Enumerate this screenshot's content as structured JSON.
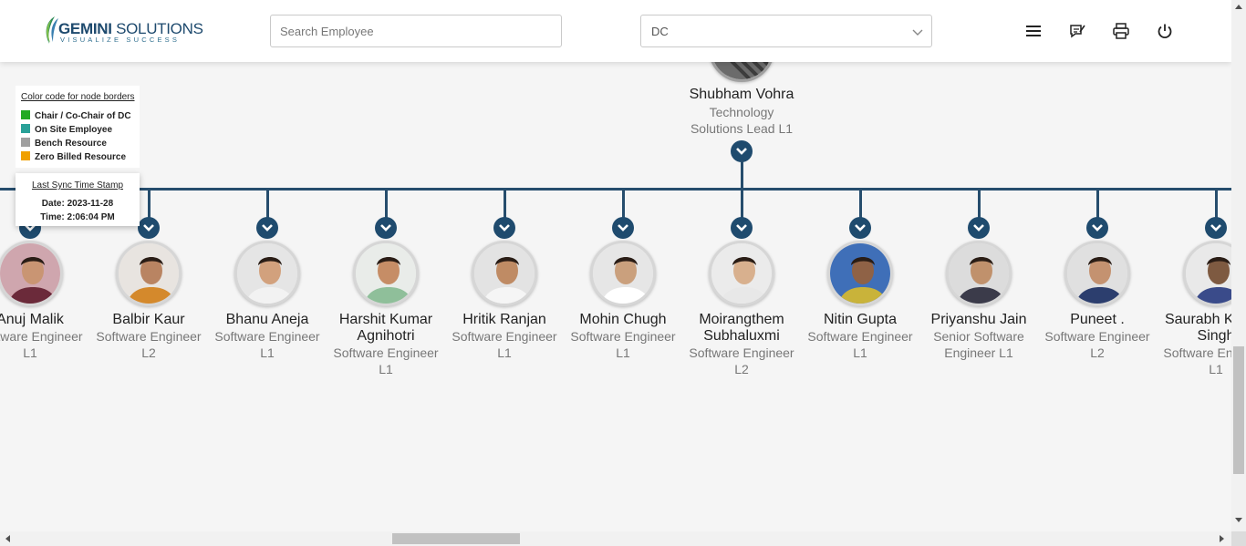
{
  "header": {
    "logo_name_bold": "GEMINI",
    "logo_name_rest": " SOLUTIONS",
    "logo_tagline": "VISUALIZE SUCCESS",
    "search_placeholder": "Search Employee",
    "dc_select_value": "DC",
    "icons": [
      "menu-icon",
      "feedback-icon",
      "print-icon",
      "power-icon"
    ]
  },
  "legend": {
    "title": "Color code for node borders",
    "items": [
      {
        "label": "Chair / Co-Chair of DC",
        "color": "#22aa22"
      },
      {
        "label": "On Site Employee",
        "color": "#2aa198"
      },
      {
        "label": "Bench Resource",
        "color": "#a0a0a0"
      },
      {
        "label": "Zero Billed Resource",
        "color": "#f0a000"
      }
    ]
  },
  "sync": {
    "title": "Last Sync Time Stamp",
    "date": "Date: 2023-11-28",
    "time": "Time: 2:06:04 PM"
  },
  "lead": {
    "name": "Shubham Vohra",
    "designation_line1": "Technology",
    "designation_line2": "Solutions Lead L1"
  },
  "employees": [
    {
      "name1": "Anuj Malik",
      "name2": "",
      "d1": "Software Engineer",
      "d2": "L1"
    },
    {
      "name1": "Balbir Kaur",
      "name2": "",
      "d1": "Software Engineer",
      "d2": "L2"
    },
    {
      "name1": "Bhanu Aneja",
      "name2": "",
      "d1": "Software Engineer",
      "d2": "L1"
    },
    {
      "name1": "Harshit Kumar",
      "name2": "Agnihotri",
      "d1": "Software Engineer",
      "d2": "L1"
    },
    {
      "name1": "Hritik Ranjan",
      "name2": "",
      "d1": "Software Engineer",
      "d2": "L1"
    },
    {
      "name1": "Mohin Chugh",
      "name2": "",
      "d1": "Software Engineer",
      "d2": "L1"
    },
    {
      "name1": "Moirangthem",
      "name2": "Subhaluxmi",
      "d1": "Software Engineer",
      "d2": "L2"
    },
    {
      "name1": "Nitin Gupta",
      "name2": "",
      "d1": "Software Engineer",
      "d2": "L1"
    },
    {
      "name1": "Priyanshu Jain",
      "name2": "",
      "d1": "Senior Software",
      "d2": "Engineer L1"
    },
    {
      "name1": "Puneet .",
      "name2": "",
      "d1": "Software Engineer",
      "d2": "L2"
    },
    {
      "name1": "Saurabh Kumar",
      "name2": "Singh",
      "d1": "Software Engineer",
      "d2": "L1"
    }
  ],
  "colors": {
    "connector": "#264d6d",
    "toggle": "#1f4b6e"
  }
}
